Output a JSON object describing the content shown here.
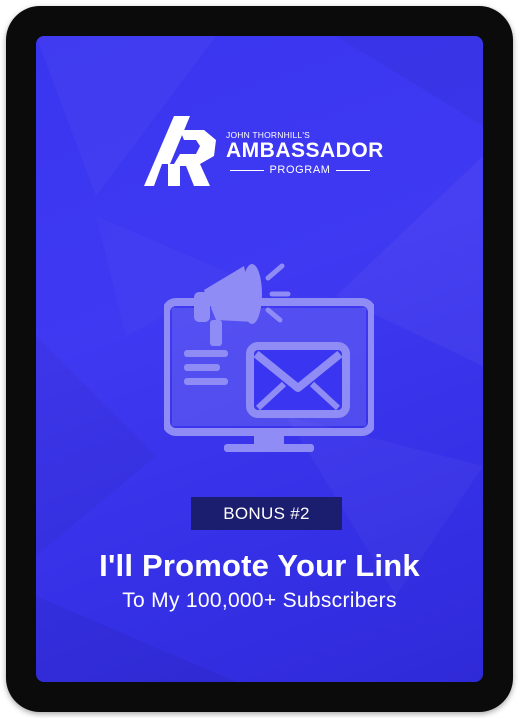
{
  "logo": {
    "subtitle": "JOHN THORNHILL'S",
    "main": "AMBASSADOR",
    "program": "PROGRAM",
    "monogram": "AP"
  },
  "illustration": {
    "icons": [
      "desktop-monitor-icon",
      "megaphone-icon",
      "envelope-icon",
      "text-lines-icon"
    ]
  },
  "badge": {
    "label": "BONUS #2"
  },
  "headline": {
    "title": "I'll Promote Your Link",
    "subtitle": "To My 100,000+ Subscribers"
  },
  "colors": {
    "background": "#3a35f0",
    "badge": "#1b1d6e",
    "illustration": "#8f8cf5",
    "text": "#ffffff",
    "frame": "#0b0b0b"
  }
}
